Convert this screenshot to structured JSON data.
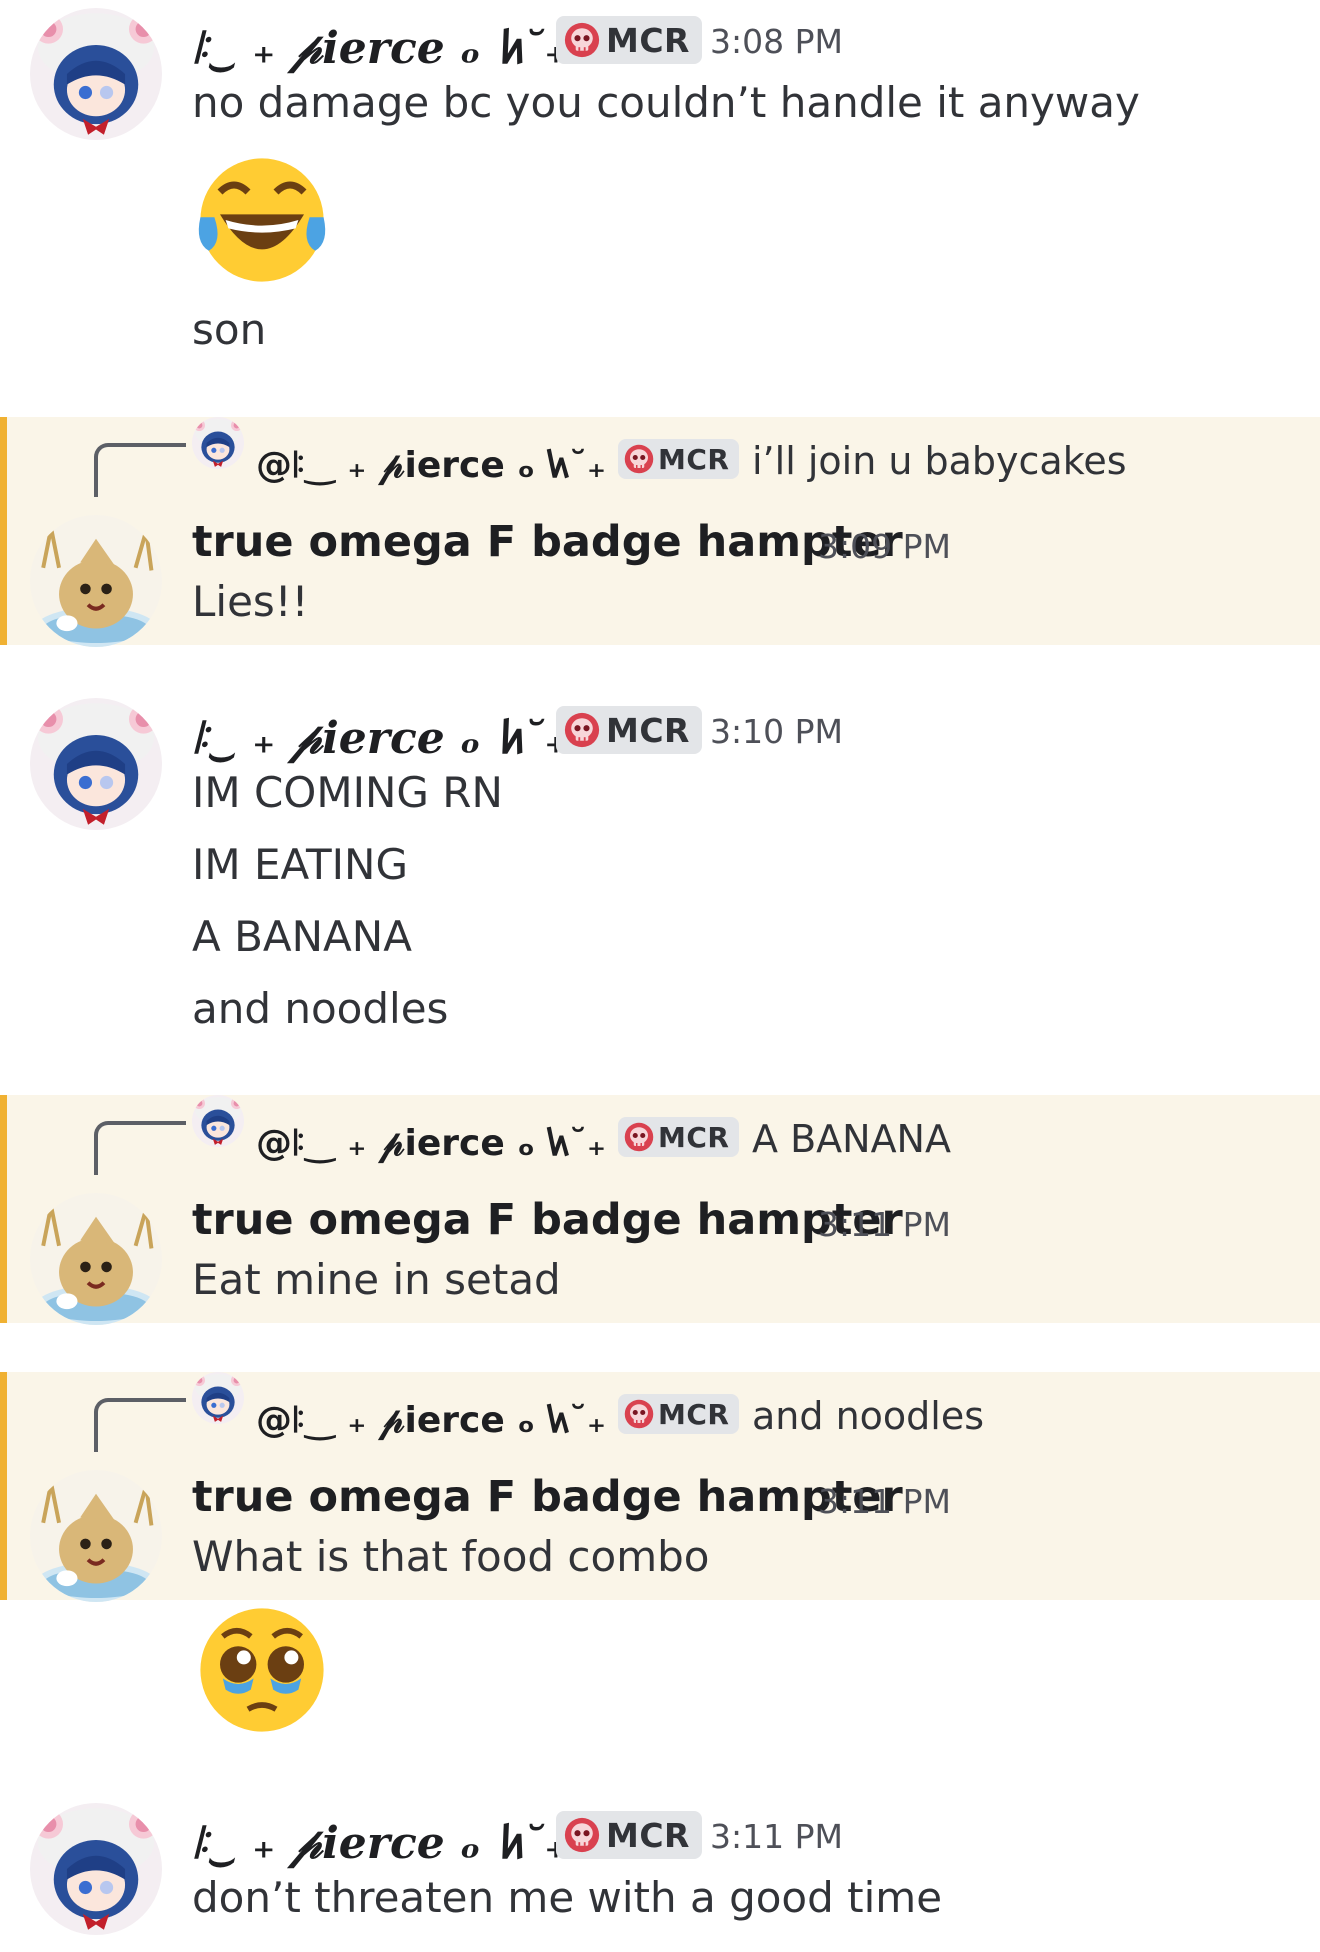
{
  "pierce": {
    "name": "ꖎ‿ ₊ 𝓅ierce ₒ 𐑿˘₊",
    "reply_name": "@ꖎ‿ ₊ 𝓅ierce ₒ 𐑿˘₊",
    "tag": "MCR"
  },
  "hampter": {
    "name": "true omega F badge hampter"
  },
  "messages": [
    {
      "time": "3:08 PM",
      "lines": [
        "no damage bc you couldn’t handle it anyway",
        "son"
      ],
      "emoji": "face-with-tears-of-joy"
    },
    {
      "time": "3:09 PM",
      "reply_text": "i’ll join u babycakes",
      "lines": [
        "Lies!!"
      ]
    },
    {
      "time": "3:10 PM",
      "lines": [
        "IM COMING RN",
        "IM EATING",
        "A BANANA",
        "and noodles"
      ]
    },
    {
      "time": "3:11 PM",
      "reply_text": "A BANANA",
      "lines": [
        "Eat mine in setad"
      ]
    },
    {
      "time": "3:11 PM",
      "reply_text": "and noodles",
      "lines": [
        "What is that food combo"
      ],
      "emoji": "pleading-face"
    },
    {
      "time": "3:11 PM",
      "lines": [
        "don’t threaten me with a good time"
      ]
    }
  ],
  "colors": {
    "highlight_bg": "#faf5e8",
    "highlight_bar": "#f0b132",
    "tag_bg": "#e3e5e8",
    "text": "#313338"
  }
}
